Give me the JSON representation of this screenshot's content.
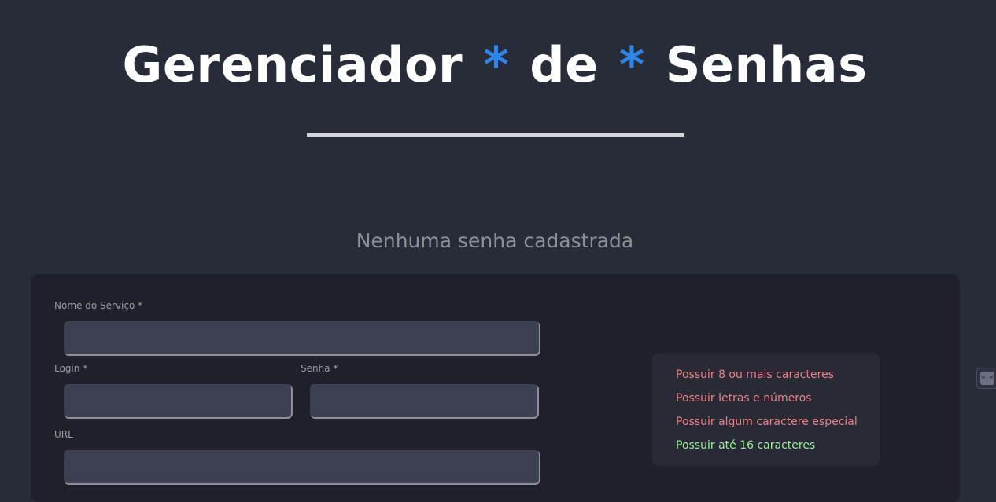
{
  "header": {
    "title_word1": "Gerenciador",
    "title_sep1": "*",
    "title_word2": "de",
    "title_sep2": "*",
    "title_word3": "Senhas",
    "accent_color": "#2f86e8"
  },
  "empty_message": "Nenhuma senha cadastrada",
  "form": {
    "service_label": "Nome do Serviço *",
    "service_value": "",
    "login_label": "Login *",
    "login_value": "",
    "password_label": "Senha *",
    "password_value": "",
    "url_label": "URL",
    "url_value": ""
  },
  "validation": {
    "rules": [
      {
        "text": "Possuir 8 ou mais caracteres",
        "valid": false
      },
      {
        "text": "Possuir letras e números",
        "valid": false
      },
      {
        "text": "Possuir algum caractere especial",
        "valid": false
      },
      {
        "text": "Possuir até 16 caracteres",
        "valid": true
      }
    ],
    "invalid_color": "#ee7f85",
    "valid_color": "#9df09d"
  },
  "side_widget": {
    "icon": "extension-face-icon",
    "glyph": ">.<"
  }
}
